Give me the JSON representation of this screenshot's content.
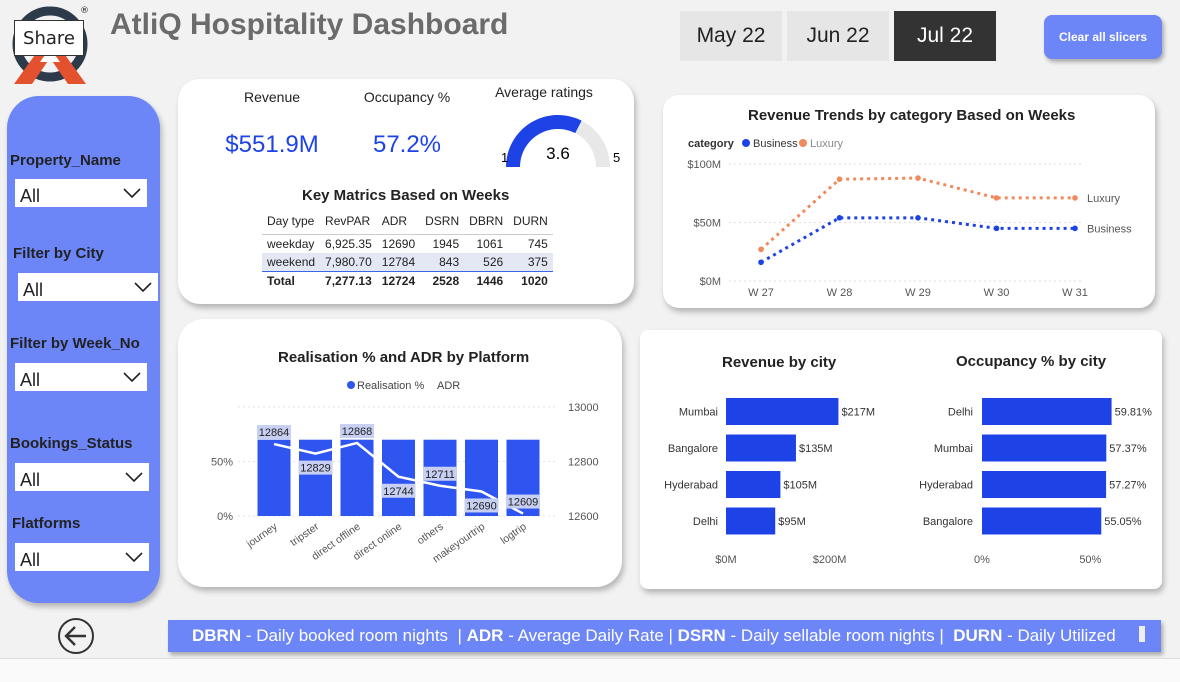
{
  "header": {
    "title": "AtliQ Hospitality Dashboard",
    "share_label": "Share",
    "registered_mark": "®",
    "months": [
      "May 22",
      "Jun 22",
      "Jul 22"
    ],
    "active_month": "Jul 22",
    "clear_label": "Clear all slicers"
  },
  "sidebar": {
    "filters": [
      {
        "label": "Property_Name",
        "value": "All"
      },
      {
        "label": "Filter by City",
        "value": "All"
      },
      {
        "label": "Filter by Week_No",
        "value": "All"
      },
      {
        "label": "Bookings_Status",
        "value": "All"
      },
      {
        "label": "Flatforms",
        "value": "All"
      }
    ],
    "back_icon": "back-arrow-icon"
  },
  "kpis": {
    "revenue_label": "Revenue",
    "revenue_value": "$551.9M",
    "occupancy_label": "Occupancy %",
    "occupancy_value": "57.2%",
    "ratings_label": "Average ratings",
    "ratings_value": "3.6",
    "ratings_min": "1",
    "ratings_max": "5",
    "ratings_fraction": 0.65
  },
  "key_metrics": {
    "title": "Key Matrics Based on Weeks",
    "columns": [
      "Day type",
      "RevPAR",
      "ADR",
      "DSRN",
      "DBRN",
      "DURN"
    ],
    "rows": [
      [
        "weekday",
        "6,925.35",
        "12690",
        "1945",
        "1061",
        "745"
      ],
      [
        "weekend",
        "7,980.70",
        "12784",
        "843",
        "526",
        "375"
      ],
      [
        "Total",
        "7,277.13",
        "12724",
        "2528",
        "1446",
        "1020"
      ]
    ]
  },
  "colors": {
    "accent": "#1d43e6",
    "sidebar": "#6c85f7",
    "business": "#1d43e6",
    "luxury": "#f08a5d",
    "bar": "#2f55f0"
  },
  "chart_data": [
    {
      "type": "line",
      "title": "Revenue Trends by category Based on Weeks",
      "legend_title": "category",
      "categories": [
        "W 27",
        "W 28",
        "W 29",
        "W 30",
        "W 31"
      ],
      "series": [
        {
          "name": "Business",
          "values": [
            16,
            54,
            54,
            45,
            45
          ]
        },
        {
          "name": "Luxury",
          "values": [
            27,
            87,
            88,
            71,
            71
          ]
        }
      ],
      "yticks": [
        "$0M",
        "$50M",
        "$100M"
      ],
      "ylim": [
        0,
        100
      ],
      "legend": "top-left"
    },
    {
      "type": "bar",
      "title": "Realisation % and ADR by Platform",
      "categories": [
        "journey",
        "tripster",
        "direct offline",
        "direct online",
        "others",
        "makeyourtrip",
        "logtrip"
      ],
      "series": [
        {
          "name": "Realisation %",
          "values": [
            70,
            70,
            70,
            70,
            70,
            70,
            70
          ]
        },
        {
          "name": "ADR",
          "values": [
            12864,
            12829,
            12868,
            12744,
            12711,
            12690,
            12609
          ]
        }
      ],
      "y_left_ticks": [
        "0%",
        "50%"
      ],
      "y_right_ticks": [
        "12600",
        "12800",
        "13000"
      ],
      "y_right_lim": [
        12600,
        13000
      ],
      "legend": "top-center"
    },
    {
      "type": "bar",
      "title": "Revenue by city",
      "categories": [
        "Mumbai",
        "Bangalore",
        "Hyderabad",
        "Delhi"
      ],
      "values": [
        217,
        135,
        105,
        95
      ],
      "labels": [
        "$217M",
        "$135M",
        "$105M",
        "$95M"
      ],
      "xticks": [
        "$0M",
        "$200M"
      ],
      "xlim": [
        0,
        220
      ]
    },
    {
      "type": "bar",
      "title": "Occupancy % by city",
      "categories": [
        "Delhi",
        "Mumbai",
        "Hyderabad",
        "Bangalore"
      ],
      "values": [
        59.81,
        57.37,
        57.27,
        55.05
      ],
      "labels": [
        "59.81%",
        "57.37%",
        "57.27%",
        "55.05%"
      ],
      "xticks": [
        "0%",
        "50%"
      ],
      "xlim": [
        0,
        60
      ]
    }
  ],
  "footer": {
    "items": [
      {
        "abbr": "DBRN",
        "text": " - Daily booked room nights  | "
      },
      {
        "abbr": "ADR",
        "text": " - Average Daily Rate | "
      },
      {
        "abbr": "DSRN",
        "text": " - Daily sellable room nights |  "
      },
      {
        "abbr": "DURN",
        "text": " - Daily Utilized"
      }
    ]
  }
}
